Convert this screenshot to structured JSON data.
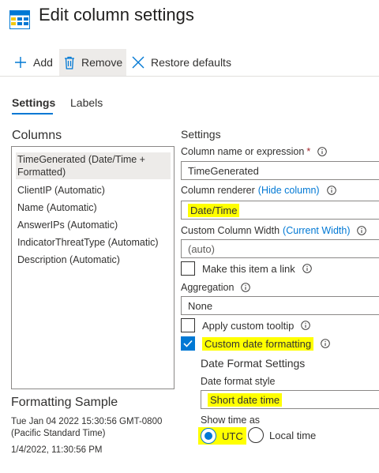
{
  "header": {
    "title": "Edit column settings",
    "icon": "table-grid-icon"
  },
  "toolbar": {
    "add_label": "Add",
    "remove_label": "Remove",
    "restore_label": "Restore defaults"
  },
  "tabs": [
    {
      "label": "Settings",
      "selected": true
    },
    {
      "label": "Labels",
      "selected": false
    }
  ],
  "columns_panel": {
    "heading": "Columns",
    "items": [
      {
        "label": "TimeGenerated (Date/Time + Formatted)",
        "selected": true
      },
      {
        "label": "ClientIP (Automatic)",
        "selected": false
      },
      {
        "label": "Name (Automatic)",
        "selected": false
      },
      {
        "label": "AnswerIPs (Automatic)",
        "selected": false
      },
      {
        "label": "IndicatorThreatType (Automatic)",
        "selected": false
      },
      {
        "label": "Description (Automatic)",
        "selected": false
      }
    ]
  },
  "formatting_sample": {
    "heading": "Formatting Sample",
    "line1": "Tue Jan 04 2022 15:30:56 GMT-0800",
    "line2": "(Pacific Standard Time)",
    "line3": "1/4/2022, 11:30:56 PM"
  },
  "settings": {
    "heading": "Settings",
    "column_name": {
      "label": "Column name or expression",
      "required_mark": "*",
      "value": "TimeGenerated"
    },
    "renderer": {
      "label": "Column renderer",
      "link": "(Hide column)",
      "value": "Date/Time"
    },
    "width": {
      "label": "Custom Column Width",
      "link": "(Current Width)",
      "placeholder": "(auto)"
    },
    "make_link": {
      "label": "Make this item a link",
      "checked": false
    },
    "aggregation": {
      "label": "Aggregation",
      "value": "None"
    },
    "custom_tooltip": {
      "label": "Apply custom tooltip",
      "checked": false
    },
    "custom_date_formatting": {
      "label": "Custom date formatting",
      "checked": true
    },
    "date_format_settings": {
      "heading": "Date Format Settings",
      "style_label": "Date format style",
      "style_value": "Short date time",
      "show_time_label": "Show time as",
      "options": [
        {
          "label": "UTC",
          "selected": true
        },
        {
          "label": "Local time",
          "selected": false
        }
      ]
    }
  },
  "colors": {
    "accent": "#0078d4",
    "highlight": "#ffff00",
    "required": "#a4262c"
  }
}
